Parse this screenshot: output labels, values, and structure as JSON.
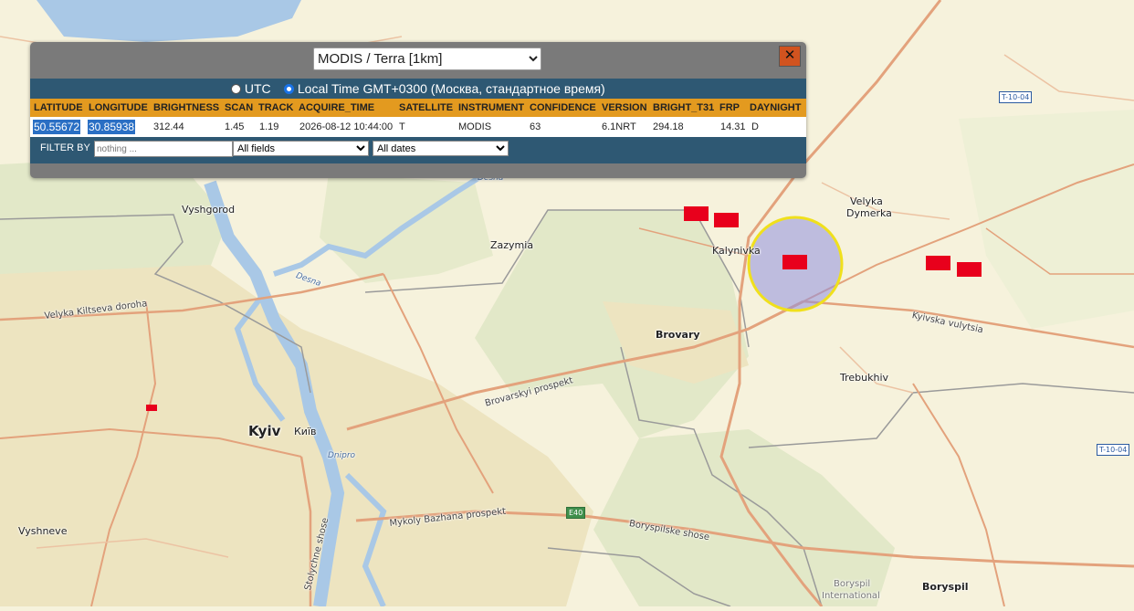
{
  "panel": {
    "satellite": "MODIS / Terra [1km]",
    "close": "✕",
    "tz_utc": "UTC",
    "tz_local": "Local Time GMT+0300 (Москва, стандартное время)",
    "tz_selected": "local",
    "columns": [
      "LATITUDE",
      "LONGITUDE",
      "BRIGHTNESS",
      "SCAN",
      "TRACK",
      "ACQUIRE_TIME",
      "SATELLITE",
      "INSTRUMENT",
      "CONFIDENCE",
      "VERSION",
      "BRIGHT_T31",
      "FRP",
      "DAYNIGHT"
    ],
    "row": {
      "latitude": "50.55672",
      "longitude": "30.85938",
      "brightness": "312.44",
      "scan": "1.45",
      "track": "1.19",
      "acquire_time": "2026-08-12 10:44:00",
      "satellite": "T",
      "instrument": "MODIS",
      "confidence": "63",
      "version": "6.1NRT",
      "bright_t31": "294.18",
      "frp": "14.31",
      "daynight": "D"
    },
    "filter_label": "FILTER BY",
    "filter_placeholder": "nothing ...",
    "field_select": "All fields",
    "date_select": "All dates"
  },
  "map": {
    "places": {
      "vyshgorod": "Vyshgorod",
      "zazymia": "Zazymia",
      "kalynivka": "Kalynivka",
      "velyka": "Velyka",
      "dymerka": "Dymerka",
      "brovary": "Brovary",
      "trebukhiv": "Trebukhiv",
      "kyiv": "Kyiv",
      "kyiv_local": "Київ",
      "vyshneve": "Vyshneve",
      "boryspil": "Boryspil",
      "airport1": "Boryspil",
      "airport2": "International"
    },
    "roads": {
      "velyka_kiltseva": "Velyka Kiltseva doroha",
      "brovarskyi": "Brovarskyi prospekt",
      "kyivska": "Kyivska vulytsia",
      "bazhana": "Mykoly Bazhana prospekt",
      "boryspilske": "Boryspilske shose",
      "stolychne": "Stolychne shose"
    },
    "water": {
      "desna1": "Desna",
      "desna2": "Desna",
      "dnipro": "Dnipro"
    },
    "shields": {
      "t1004a": "T-10-04",
      "t1004b": "T-10-04",
      "e40": "E40"
    },
    "colors": {
      "land": "#f6f2dc",
      "urban": "#ece4c2",
      "forest": "#dfe6c6",
      "water": "#a9c8e6",
      "road": "#e5a07a",
      "hotspot": "#e8001c",
      "highlight_fill": "#8f8fe6",
      "highlight_ring": "#f0e01c"
    }
  }
}
